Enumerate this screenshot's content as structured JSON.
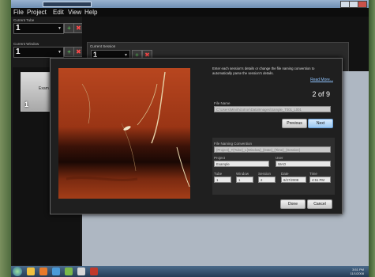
{
  "menu": [
    "File",
    "Project",
    "Edit",
    "View",
    "Help"
  ],
  "left_panel": {
    "current_tube_label": "Current Tube",
    "current_tube_value": "1",
    "current_window_label": "Current Window",
    "current_window_value": "1",
    "thumbnail": {
      "label": "Exam",
      "number": "1"
    }
  },
  "session_panel": {
    "label": "Current Session",
    "value": "1"
  },
  "dialog": {
    "instructions": "Enter each session's details or change the file naming convention to automatically parse the session's details.",
    "read_more": "Read More...",
    "counter": "2 of 9",
    "file_name_label": "File Name",
    "file_name_value": "C:\\Users\\Minirhizotron\\Data\\Images\\Sample_T001_L001",
    "previous_button": "Previous",
    "next_button": "Next",
    "naming_convention_label": "File Naming Convention",
    "naming_convention_value": "{Project}_T{Tube}_L{Window}_{Date}_{Time}_{Session}",
    "project_label": "Project",
    "project_value": "Example",
    "user_label": "User",
    "user_value": "WAO",
    "tube_label": "Tube",
    "tube_value": "1",
    "window_label": "Window",
    "window_value": "1",
    "session_label": "Session",
    "session_value": "2",
    "date_label": "Date",
    "date_value": "8/27/2008",
    "time_label": "Time",
    "time_value": "4:51 PM",
    "done_button": "Done",
    "cancel_button": "Cancel"
  },
  "taskbar": {
    "clock_time": "3:51 PM",
    "clock_date": "11/1/2008"
  }
}
